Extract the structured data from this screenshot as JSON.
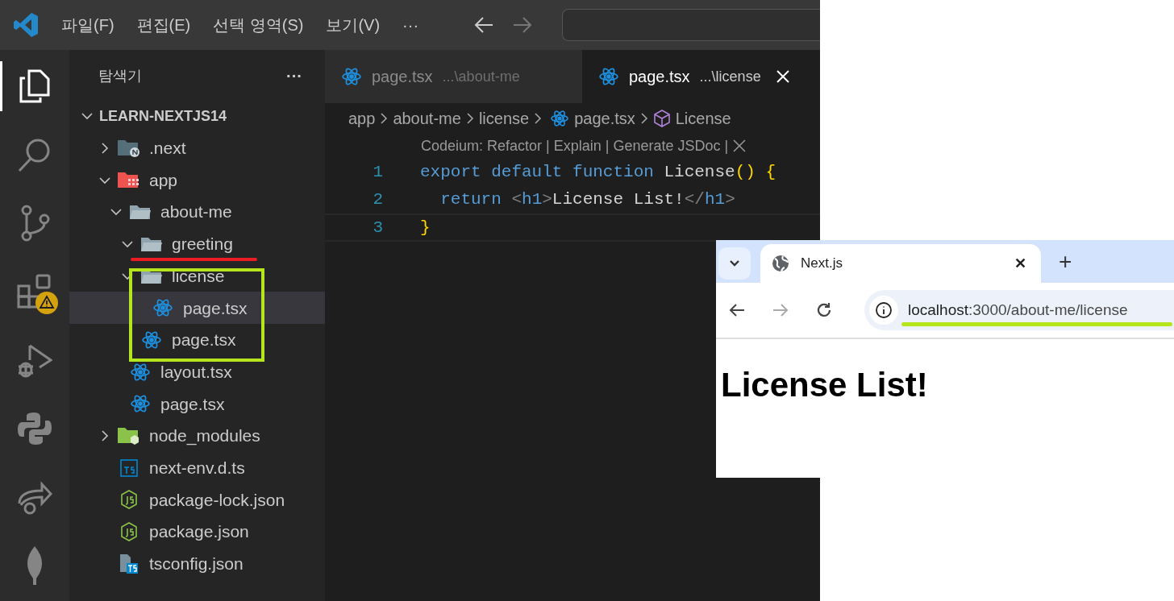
{
  "menu": [
    "파일(F)",
    "편집(E)",
    "선택 영역(S)",
    "보기(V)",
    "···"
  ],
  "activity_bar": [
    {
      "kind": "explorer",
      "selected": true,
      "warning": false
    },
    {
      "kind": "search",
      "selected": false,
      "warning": false
    },
    {
      "kind": "scm",
      "selected": false,
      "warning": false
    },
    {
      "kind": "extensions",
      "selected": false,
      "warning": true
    },
    {
      "kind": "debug",
      "selected": false,
      "warning": false
    },
    {
      "kind": "python",
      "selected": false,
      "warning": false
    },
    {
      "kind": "share",
      "selected": false,
      "warning": false
    },
    {
      "kind": "leaf",
      "selected": false,
      "warning": false
    }
  ],
  "sidebar": {
    "title": "탐색기",
    "more": "···",
    "root": {
      "label": "LEARN-NEXTJS14",
      "expanded": true
    },
    "items": [
      {
        "label": ".next",
        "kind": "folder-next",
        "expanded": false,
        "selected": false
      },
      {
        "label": "app",
        "kind": "folder-app",
        "expanded": true,
        "selected": false,
        "children": [
          {
            "label": "about-me",
            "kind": "folder",
            "expanded": true,
            "selected": false,
            "children": [
              {
                "label": "greeting",
                "kind": "folder",
                "expanded": true,
                "selected": false
              },
              {
                "label": "license",
                "kind": "folder",
                "expanded": true,
                "selected": false,
                "children": [
                  {
                    "label": "page.tsx",
                    "kind": "react",
                    "selected": true
                  }
                ]
              },
              {
                "label": "page.tsx",
                "kind": "react",
                "selected": false
              }
            ]
          },
          {
            "label": "layout.tsx",
            "kind": "react",
            "selected": false
          },
          {
            "label": "page.tsx",
            "kind": "react",
            "selected": false
          }
        ]
      },
      {
        "label": "node_modules",
        "kind": "folder-node",
        "expanded": false,
        "selected": false
      },
      {
        "label": "next-env.d.ts",
        "kind": "ts",
        "selected": false
      },
      {
        "label": "package-lock.json",
        "kind": "js",
        "selected": false
      },
      {
        "label": "package.json",
        "kind": "js",
        "selected": false
      },
      {
        "label": "tsconfig.json",
        "kind": "tsconfig",
        "selected": false
      }
    ]
  },
  "tabs": [
    {
      "label": "page.tsx",
      "path": "...\\about-me",
      "selected": false
    },
    {
      "label": "page.tsx",
      "path": "...\\license",
      "selected": true
    }
  ],
  "breadcrumb": [
    {
      "label": "app",
      "kind": "text"
    },
    {
      "label": "about-me",
      "kind": "text"
    },
    {
      "label": "license",
      "kind": "text"
    },
    {
      "label": "page.tsx",
      "kind": "react"
    },
    {
      "label": "License",
      "kind": "symbol"
    }
  ],
  "code_lens": "Codeium: Refactor | Explain | Generate JSDoc |",
  "code": [
    {
      "number": "1",
      "tokens": [
        {
          "text": "export default function ",
          "kind": "keyword"
        },
        {
          "text": "License",
          "kind": "plain"
        },
        {
          "text": "()",
          "kind": "bracket"
        },
        {
          "text": " {",
          "kind": "bracket"
        }
      ]
    },
    {
      "number": "2",
      "tokens": [
        {
          "text": "  return ",
          "kind": "keyword"
        },
        {
          "text": "<",
          "kind": "punct"
        },
        {
          "text": "h1",
          "kind": "tag"
        },
        {
          "text": ">",
          "kind": "punct"
        },
        {
          "text": "License List!",
          "kind": "plain"
        },
        {
          "text": "</",
          "kind": "punct"
        },
        {
          "text": "h1",
          "kind": "tag"
        },
        {
          "text": ">",
          "kind": "punct"
        }
      ]
    },
    {
      "number": "3",
      "tokens": [
        {
          "text": "}",
          "kind": "bracket"
        }
      ]
    }
  ],
  "browser": {
    "tab": {
      "title": "Next.js",
      "close": "✕"
    },
    "new_tab": "+",
    "url_host": "localhost",
    "url_rest": ":3000/about-me/license",
    "heading": "License List!"
  }
}
